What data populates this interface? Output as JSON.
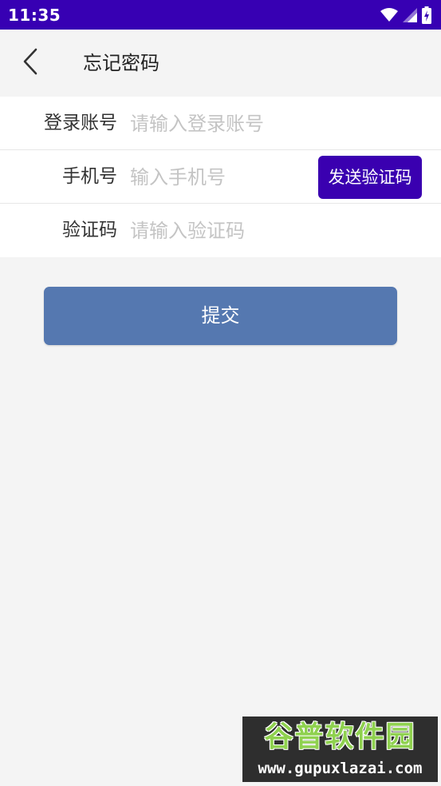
{
  "status_bar": {
    "time": "11:35",
    "icons": [
      "wifi-icon",
      "signal-icon",
      "battery-charging-icon"
    ]
  },
  "app_bar": {
    "back_icon": "chevron-left-icon",
    "title": "忘记密码"
  },
  "form": {
    "account": {
      "label": "登录账号",
      "placeholder": "请输入登录账号",
      "value": ""
    },
    "phone": {
      "label": "手机号",
      "placeholder": "输入手机号",
      "value": ""
    },
    "code": {
      "label": "验证码",
      "placeholder": "请输入验证码",
      "value": ""
    },
    "send_code_label": "发送验证码"
  },
  "submit_label": "提交",
  "watermark": {
    "title": "谷普软件园",
    "url": "www.gupuxlazai.com"
  },
  "colors": {
    "status_bar": "#3700b3",
    "send_code_button": "#3a00b0",
    "submit_button": "#5578b0",
    "background": "#f4f4f4"
  }
}
